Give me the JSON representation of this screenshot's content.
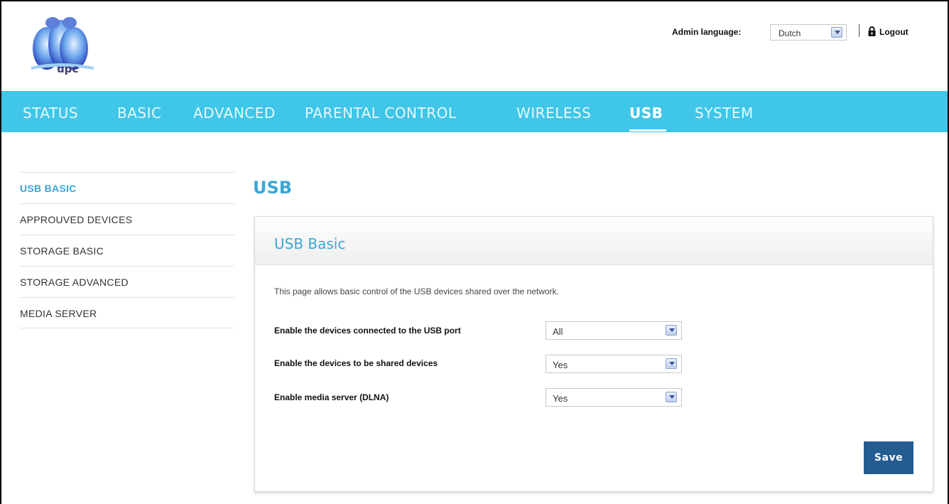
{
  "header": {
    "logo_text": "upc",
    "admin_language_label": "Admin language:",
    "admin_language_value": "Dutch",
    "logout_label": "Logout"
  },
  "nav": {
    "items": [
      {
        "label": "STATUS"
      },
      {
        "label": "BASIC"
      },
      {
        "label": "ADVANCED"
      },
      {
        "label": "PARENTAL CONTROL"
      },
      {
        "label": "WIRELESS"
      },
      {
        "label": "USB"
      },
      {
        "label": "SYSTEM"
      }
    ],
    "active": "USB"
  },
  "sidebar": {
    "items": [
      {
        "label": "USB BASIC"
      },
      {
        "label": "APPROUVED DEVICES"
      },
      {
        "label": "STORAGE BASIC"
      },
      {
        "label": "STORAGE ADVANCED"
      },
      {
        "label": "MEDIA SERVER"
      }
    ],
    "active": "USB BASIC"
  },
  "main": {
    "page_title": "USB",
    "panel_title": "USB Basic",
    "description": "This page allows basic control of the USB devices shared over the network.",
    "fields": [
      {
        "label": "Enable the devices connected to the USB port",
        "value": "All"
      },
      {
        "label": "Enable the devices to be shared devices",
        "value": "Yes"
      },
      {
        "label": "Enable media server (DLNA)",
        "value": "Yes"
      }
    ],
    "save_label": "Save"
  },
  "colors": {
    "nav_background": "#3fc6e8",
    "accent": "#3aa6d6",
    "button": "#245b91"
  },
  "icons": [
    "upc-logo-icon",
    "chevron-down-icon",
    "lock-icon"
  ]
}
